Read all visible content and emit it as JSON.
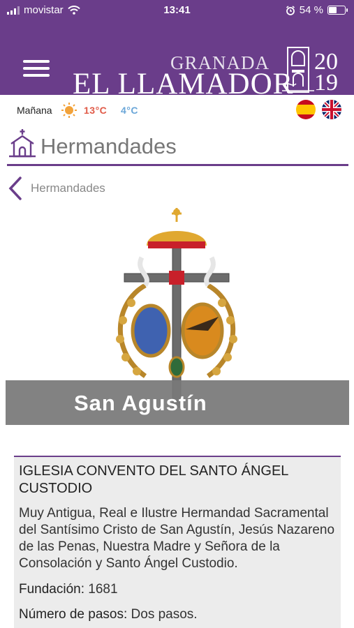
{
  "status_bar": {
    "carrier": "movistar",
    "time": "13:41",
    "battery": "54 %",
    "battery_level": 0.54
  },
  "header": {
    "brand_top": "GRANADA",
    "brand_main": "EL LLAMADOR",
    "year_top": "20",
    "year_bottom": "19",
    "menu_icon": "hamburger-menu-icon"
  },
  "weather": {
    "day": "Mañana",
    "icon": "sun-icon",
    "max": "13°C",
    "min": "4°C",
    "max_color": "#e05a47",
    "min_color": "#6aa6d8"
  },
  "languages": [
    {
      "code": "es",
      "icon": "spain-flag-icon"
    },
    {
      "code": "en",
      "icon": "uk-flag-icon"
    }
  ],
  "section": {
    "title": "Hermandades",
    "icon": "church-icon"
  },
  "back": {
    "label": "Hermandades",
    "icon": "chevron-left-icon"
  },
  "brotherhood": {
    "name": "San Agustín",
    "church": "IGLESIA CONVENTO DEL SANTO ÁNGEL CUSTODIO",
    "full_name": "Muy Antigua, Real e Ilustre Hermandad Sacramental del Santísimo Cristo de San Agustín, Jesús Nazareno de las Penas, Nuestra Madre y Señora de la Consolación y Santo Ángel Custodio.",
    "founded_label": "Fundación:",
    "founded_value": "1681",
    "pasos_label": "Número de pasos:",
    "pasos_value": "Dos pasos."
  },
  "colors": {
    "brand_purple": "#6a3d8a",
    "banner_gray": "#787878",
    "card_bg": "#ececec"
  }
}
